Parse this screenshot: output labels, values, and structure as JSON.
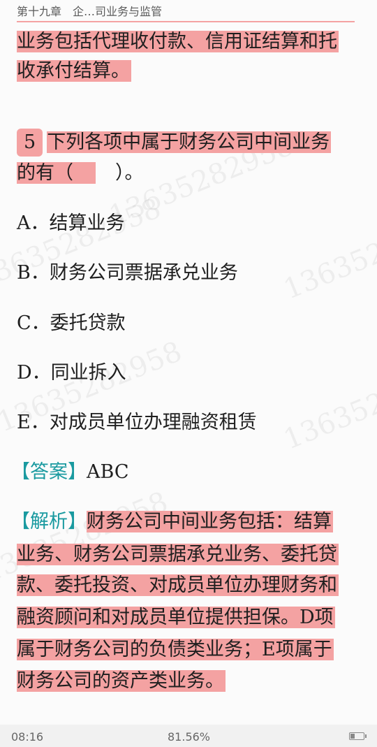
{
  "header": {
    "title": "第十九章　企…司业务与监管"
  },
  "watermark": {
    "text": "13635282958"
  },
  "prev_explanation": {
    "lines": [
      "业务包括代理收付款、信用证结算和托",
      "收承付结算。"
    ]
  },
  "question": {
    "number": "5",
    "stem_line1": "下列各项中属于财务公司中间业务",
    "stem_line2_a": "的有（",
    "stem_line2_b": "）。",
    "options": [
      {
        "letter": "A",
        "text": "A．结算业务"
      },
      {
        "letter": "B",
        "text": "B．财务公司票据承兑业务"
      },
      {
        "letter": "C",
        "text": "C．委托贷款"
      },
      {
        "letter": "D",
        "text": "D．同业拆入"
      },
      {
        "letter": "E",
        "text": "E．对成员单位办理融资租赁"
      }
    ]
  },
  "answer": {
    "tag": "【答案】",
    "value": "ABC"
  },
  "explanation": {
    "tag": "【解析】",
    "lines": [
      "财务公司中间业务包括：结算",
      "业务、财务公司票据承兑业务、委托贷",
      "款、委托投资、对成员单位办理财务和",
      "融资顾问和对成员单位提供担保。D项",
      "属于财务公司的负债类业务；E项属于",
      "财务公司的资产类业务。"
    ]
  },
  "status": {
    "time": "08:16",
    "progress": "81.56%",
    "progress_value": 0.8156
  },
  "colors": {
    "highlight": "#f4a2a2",
    "tag": "#1a9aa0"
  }
}
